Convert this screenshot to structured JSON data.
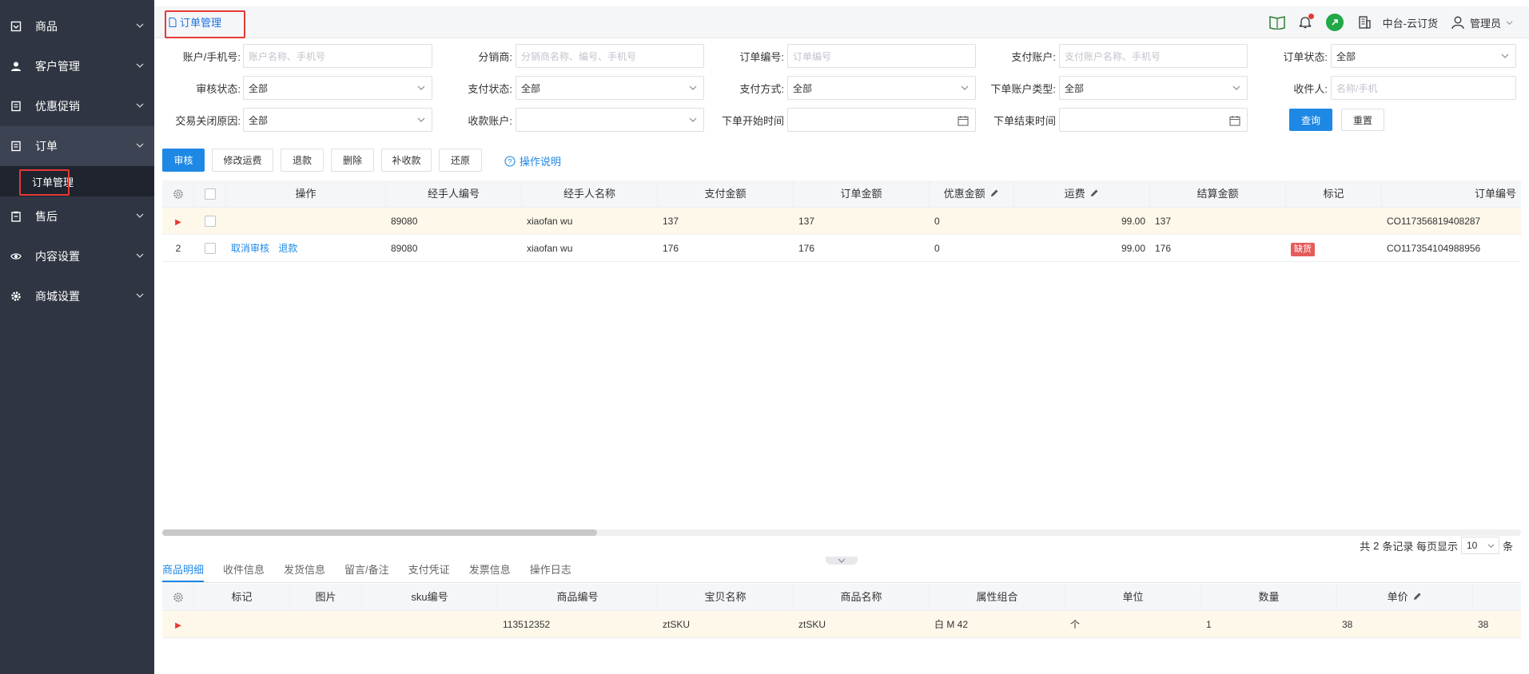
{
  "sidebar": {
    "items": [
      {
        "label": "商品",
        "icon": "box-icon"
      },
      {
        "label": "客户管理",
        "icon": "user-icon"
      },
      {
        "label": "优惠促销",
        "icon": "doc-icon"
      },
      {
        "label": "订单",
        "icon": "doc-icon"
      },
      {
        "label": "售后",
        "icon": "clipboard-icon"
      },
      {
        "label": "内容设置",
        "icon": "eye-icon"
      },
      {
        "label": "商城设置",
        "icon": "gear-icon"
      }
    ],
    "sub_item": "订单管理"
  },
  "topbar": {
    "tab_title": "订单管理",
    "store": "中台-云订货",
    "user": "管理员"
  },
  "filters": {
    "account": {
      "label": "账户/手机号:",
      "placeholder": "账户名称、手机号"
    },
    "distributor": {
      "label": "分销商:",
      "placeholder": "分销商名称、编号、手机号"
    },
    "order_no": {
      "label": "订单编号:",
      "placeholder": "订单编号"
    },
    "pay_account": {
      "label": "支付账户:",
      "placeholder": "支付账户名称、手机号"
    },
    "order_status": {
      "label": "订单状态:",
      "value": "全部"
    },
    "audit_status": {
      "label": "审核状态:",
      "value": "全部"
    },
    "pay_status": {
      "label": "支付状态:",
      "value": "全部"
    },
    "pay_method": {
      "label": "支付方式:",
      "value": "全部"
    },
    "account_type": {
      "label": "下单账户类型:",
      "value": "全部"
    },
    "receiver": {
      "label": "收件人:",
      "placeholder": "名称/手机"
    },
    "close_reason": {
      "label": "交易关闭原因:",
      "value": "全部"
    },
    "receive_account": {
      "label": "收款账户:",
      "value": ""
    },
    "start_time": {
      "label": "下单开始时间"
    },
    "end_time": {
      "label": "下单结束时间"
    },
    "query": "查询",
    "reset": "重置"
  },
  "actions": {
    "audit": "审核",
    "edit_freight": "修改运费",
    "refund": "退款",
    "delete": "删除",
    "supplement": "补收款",
    "restore": "还原",
    "help": "操作说明"
  },
  "table": {
    "headers": [
      "操作",
      "经手人编号",
      "经手人名称",
      "支付金额",
      "订单金额",
      "优惠金额",
      "运费",
      "结算金额",
      "标记",
      "订单编号"
    ],
    "rows": [
      {
        "index": "",
        "ops": [],
        "handler_no": "89080",
        "handler_name": "xiaofan wu",
        "paid": "137",
        "order_amt": "137",
        "discount": "0",
        "freight": "99.00",
        "settle": "137",
        "tag": "",
        "order_no": "CO117356819408287"
      },
      {
        "index": "2",
        "ops": [
          "取消审核",
          "退款"
        ],
        "handler_no": "89080",
        "handler_name": "xiaofan wu",
        "paid": "176",
        "order_amt": "176",
        "discount": "0",
        "freight": "99.00",
        "settle": "176",
        "tag": "缺货",
        "order_no": "CO117354104988956"
      }
    ]
  },
  "pager": {
    "total_prefix": "共",
    "total": "2",
    "total_suffix": "条记录 每页显示",
    "page_size": "10",
    "unit": "条"
  },
  "bottom_tabs": [
    "商品明细",
    "收件信息",
    "发货信息",
    "留言/备注",
    "支付凭证",
    "发票信息",
    "操作日志"
  ],
  "detail": {
    "headers": [
      "标记",
      "图片",
      "sku编号",
      "商品编号",
      "宝贝名称",
      "商品名称",
      "属性组合",
      "单位",
      "数量",
      "单价"
    ],
    "rows": [
      {
        "tag": "",
        "img": "",
        "sku": "",
        "product_no": "113512352",
        "item_name": "ztSKU",
        "product_name": "ztSKU",
        "attrs": "白 M 42",
        "unit": "个",
        "qty": "1",
        "price": "38",
        "extra": "38"
      }
    ]
  }
}
